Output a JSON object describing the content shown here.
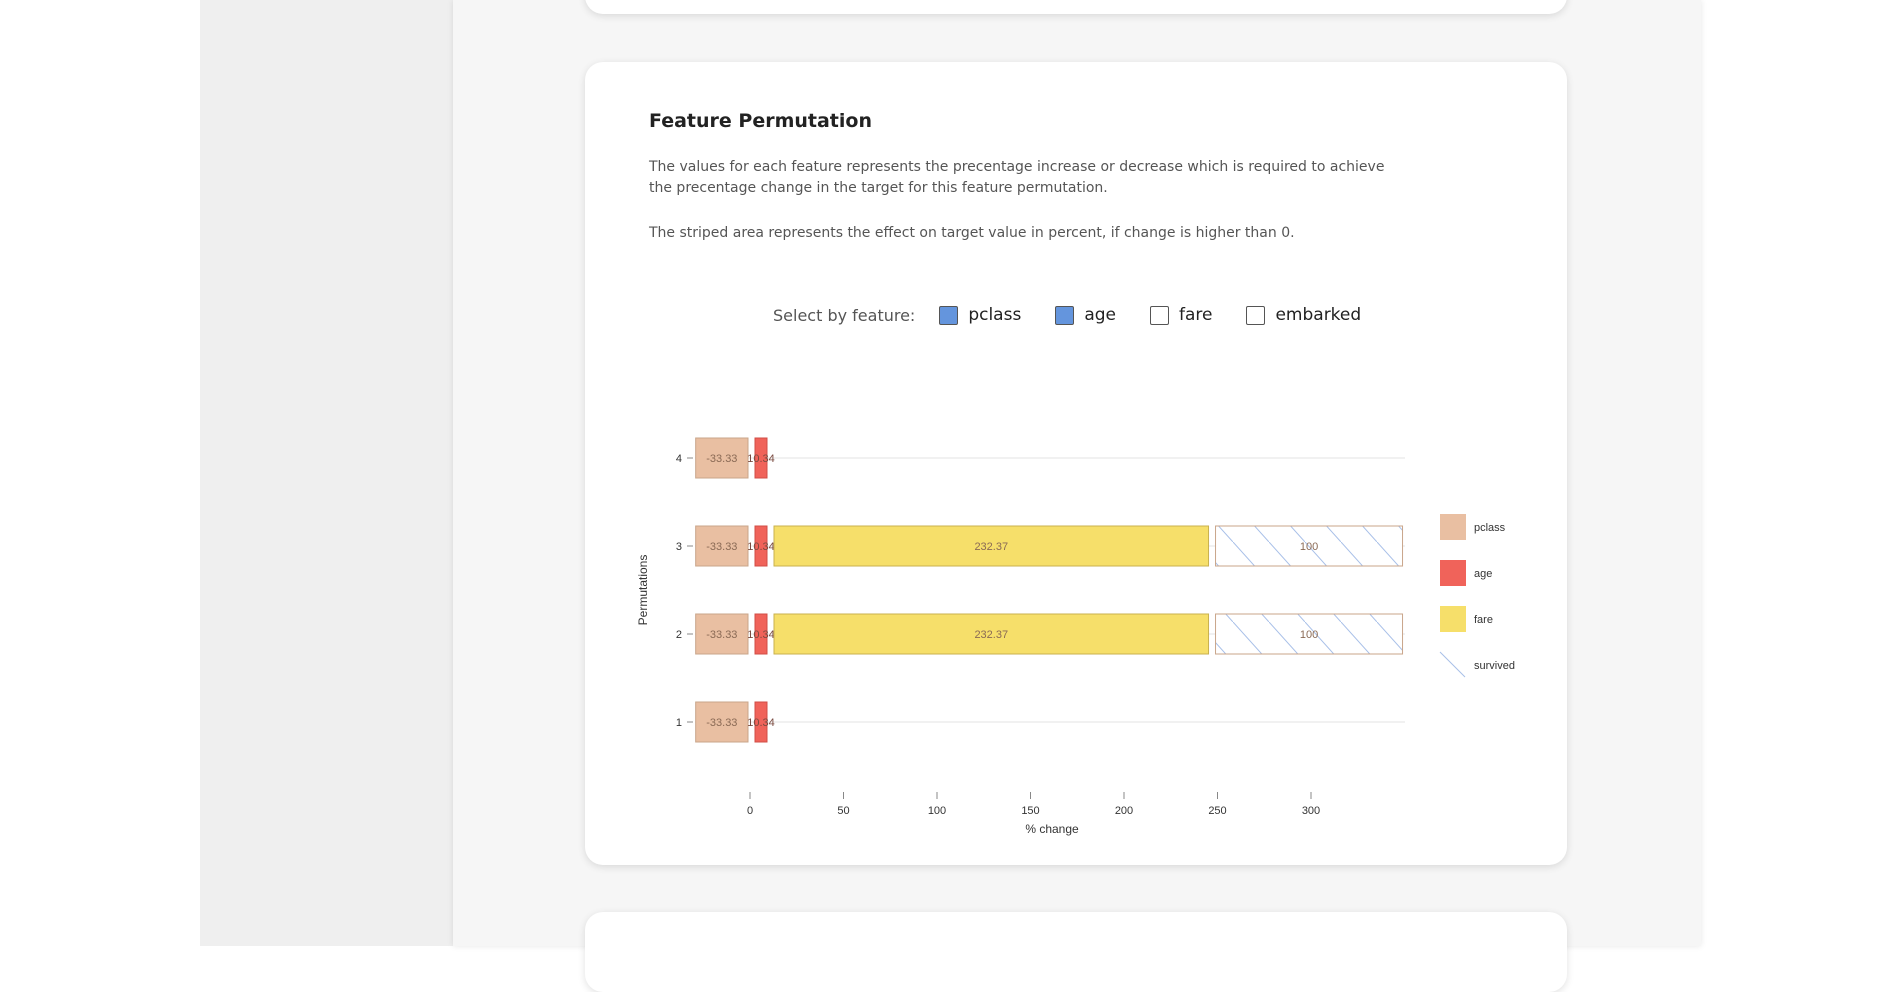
{
  "section": {
    "title": "Feature Permutation",
    "description_1": "The values for each feature represents the precentage increase or decrease which is required to achieve the precentage change in the target for this feature permutation.",
    "description_2": "The striped area represents the effect on target value in percent, if change is higher than 0."
  },
  "selector": {
    "label": "Select by feature:",
    "options": [
      {
        "label": "pclass",
        "checked": true
      },
      {
        "label": "age",
        "checked": true
      },
      {
        "label": "fare",
        "checked": false
      },
      {
        "label": "embarked",
        "checked": false
      }
    ]
  },
  "colors": {
    "pclass": "#e9bfa2",
    "age": "#f0635a",
    "fare": "#f6df6a",
    "checkbox_checked": "#6495dd"
  },
  "chart_data": {
    "type": "bar",
    "orientation": "horizontal",
    "stacked": true,
    "xlabel": "% change",
    "ylabel": "Permutations",
    "xticks": [
      0,
      50,
      100,
      150,
      200,
      250,
      300
    ],
    "xlim": [
      -32,
      345
    ],
    "categories": [
      "1",
      "2",
      "3",
      "4"
    ],
    "series": [
      {
        "name": "pclass",
        "key": "pclass",
        "values": [
          -33.33,
          -33.33,
          -33.33,
          -33.33
        ]
      },
      {
        "name": "age",
        "key": "age",
        "values": [
          10.34,
          10.34,
          10.34,
          10.34
        ]
      },
      {
        "name": "fare",
        "key": "fare",
        "values": [
          null,
          232.37,
          232.37,
          null
        ]
      },
      {
        "name": "survived",
        "key": "survived",
        "values": [
          null,
          100,
          100,
          null
        ],
        "pattern": "striped"
      }
    ],
    "legend": [
      "pclass",
      "age",
      "fare",
      "survived"
    ],
    "legend_position": "right"
  }
}
